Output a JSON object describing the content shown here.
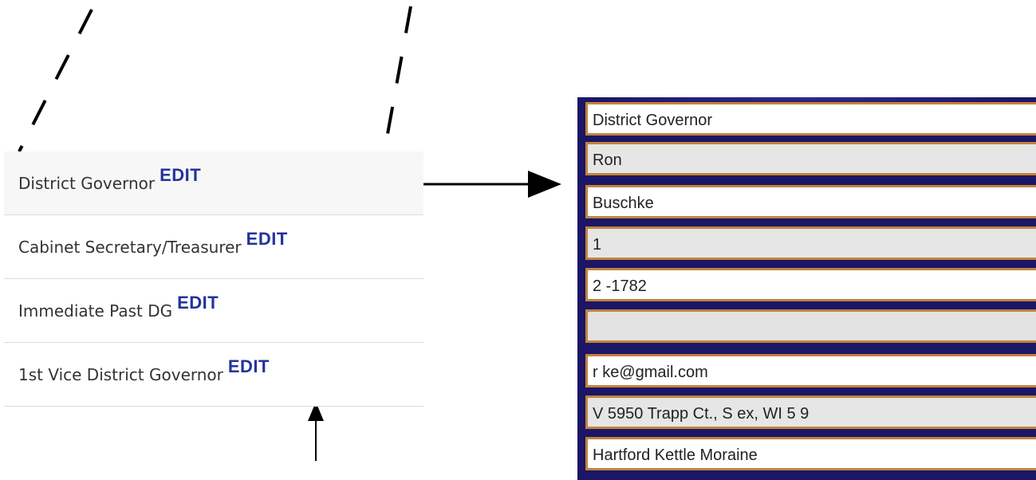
{
  "roles": [
    {
      "label": "District Governor",
      "edit": "EDIT"
    },
    {
      "label": "Cabinet Secretary/Treasurer",
      "edit": "EDIT"
    },
    {
      "label": "Immediate Past DG",
      "edit": "EDIT"
    },
    {
      "label": "1st Vice District Governor",
      "edit": "EDIT"
    }
  ],
  "form": {
    "title": "District Governor",
    "first_name": "Ron",
    "last_name": "Buschke",
    "phone1": "1",
    "phone2": "2  -1782",
    "fax": "",
    "email": "r   ke@gmail.com",
    "address": "V   5950 Trapp Ct., S   ex, WI 5   9",
    "club": "Hartford Kettle Moraine"
  }
}
